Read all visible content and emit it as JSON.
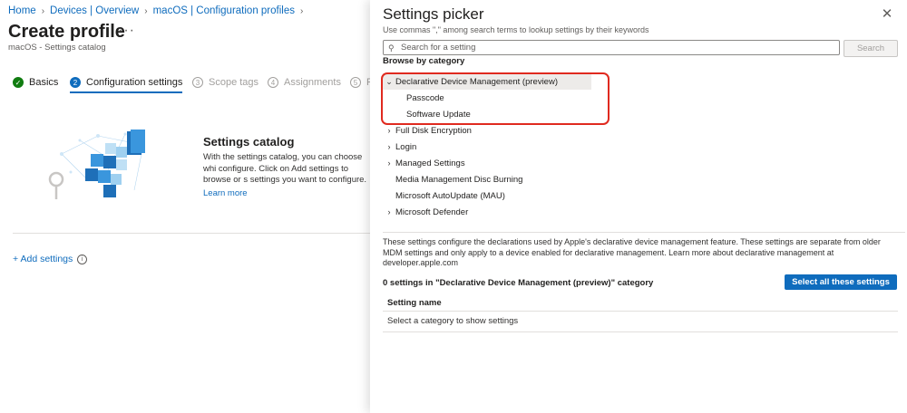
{
  "breadcrumb": [
    "Home",
    "Devices | Overview",
    "macOS | Configuration profiles"
  ],
  "page": {
    "title": "Create profile",
    "subtitle": "macOS - Settings catalog",
    "more_glyph": "···"
  },
  "steps": [
    {
      "num": "✓",
      "label": "Basics",
      "state": "done"
    },
    {
      "num": "2",
      "label": "Configuration settings",
      "state": "current"
    },
    {
      "num": "3",
      "label": "Scope tags",
      "state": "todo"
    },
    {
      "num": "4",
      "label": "Assignments",
      "state": "todo"
    },
    {
      "num": "5",
      "label": "R",
      "state": "todo"
    }
  ],
  "catalog": {
    "title": "Settings catalog",
    "description": "With the settings catalog, you can choose whi configure. Click on Add settings to browse or s settings you want to configure.",
    "learn_more": "Learn more",
    "add_settings": "+ Add settings"
  },
  "picker": {
    "title": "Settings picker",
    "hint": "Use commas \",\" among search terms to lookup settings by their keywords",
    "search_placeholder": "Search for a setting",
    "search_button": "Search",
    "browse_label": "Browse by category",
    "categories": [
      {
        "label": "Declarative Device Management (preview)",
        "chevron": "expanded",
        "selected": true
      },
      {
        "label": "Passcode",
        "child": true
      },
      {
        "label": "Software Update",
        "child": true
      },
      {
        "label": "Full Disk Encryption",
        "chevron": "collapsed"
      },
      {
        "label": "Login",
        "chevron": "collapsed"
      },
      {
        "label": "Managed Settings",
        "chevron": "collapsed"
      },
      {
        "label": "Media Management Disc Burning",
        "chevron": "none"
      },
      {
        "label": "Microsoft AutoUpdate (MAU)",
        "chevron": "none"
      },
      {
        "label": "Microsoft Defender",
        "chevron": "collapsed"
      }
    ],
    "category_description": "These settings configure the declarations used by Apple's declarative device management feature. These settings are separate from older MDM settings and only apply to a device enabled for declarative management. Learn more about declarative management at developer.apple.com",
    "settings_count": "0 settings in \"Declarative Device Management (preview)\" category",
    "select_all": "Select all these settings",
    "table_header": "Setting name",
    "table_empty": "Select a category to show settings"
  },
  "colors": {
    "accent": "#0f6cbd",
    "done": "#107c10",
    "highlight": "#e02a1f"
  }
}
